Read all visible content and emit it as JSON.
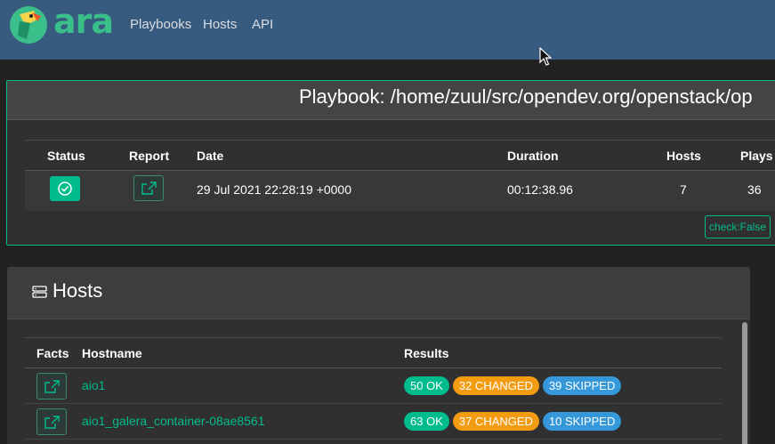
{
  "navbar": {
    "brand": "ara",
    "links": [
      "Playbooks",
      "Hosts",
      "API"
    ]
  },
  "playbook": {
    "title": "Playbook: /home/zuul/src/opendev.org/openstack/op",
    "columns": [
      "Status",
      "Report",
      "Date",
      "Duration",
      "Hosts",
      "Plays"
    ],
    "row": {
      "status": "completed",
      "date": "29 Jul 2021 22:28:19 +0000",
      "duration": "00:12:38.96",
      "hosts": "7",
      "plays": "36"
    },
    "check_label": "check:False"
  },
  "hosts": {
    "title": "Hosts",
    "columns": [
      "Facts",
      "Hostname",
      "Results"
    ],
    "rows": [
      {
        "hostname": "aio1",
        "ok": "50 OK",
        "changed": "32 CHANGED",
        "skipped": "39 SKIPPED"
      },
      {
        "hostname": "aio1_galera_container-08ae8561",
        "ok": "63 OK",
        "changed": "37 CHANGED",
        "skipped": "10 SKIPPED"
      }
    ]
  },
  "colors": {
    "navbar": "#375a7f",
    "accent": "#00bc8c",
    "changed": "#f39c12",
    "skipped": "#3498db"
  },
  "icons": [
    "ara-parrot-logo",
    "check-circle-icon",
    "external-link-icon",
    "server-icon",
    "mouse-cursor-icon"
  ]
}
